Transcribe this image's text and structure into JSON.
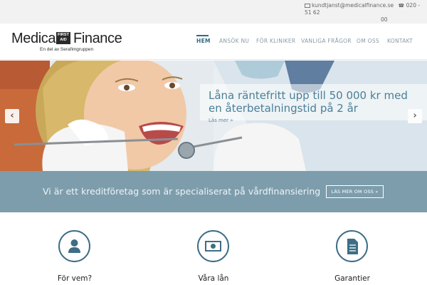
{
  "topbar": {
    "email": "kundtjanst@medicalfinance.se",
    "phone_part1": "020 - 51 62",
    "phone_part2": "00"
  },
  "logo": {
    "word1": "Medical",
    "badge_line1": "FIRST",
    "badge_line2": "AID",
    "word2": "Finance",
    "tagline": "En del av Serafimgruppen"
  },
  "nav": {
    "items": [
      "HEM",
      "ANSÖK NU",
      "FÖR KLINIKER",
      "VANLIGA FRÅGOR",
      "OM OSS",
      "KONTAKT"
    ],
    "active": "HEM"
  },
  "hero": {
    "title": "Låna räntefritt upp till 50 000 kr med en återbetalningstid på 2 år",
    "link": "Läs mer »",
    "prev_symbol": "‹",
    "next_symbol": "›"
  },
  "banner": {
    "text": "Vi är ett kreditföretag som är specialiserat på vårdfinansiering",
    "button": "LÄS MER OM OSS »"
  },
  "features": [
    {
      "label": "För vem?",
      "icon": "user-icon"
    },
    {
      "label": "Våra lån",
      "icon": "money-icon"
    },
    {
      "label": "Garantier",
      "icon": "document-icon"
    }
  ],
  "colors": {
    "accent": "#2f6a87",
    "banner": "#7d9dac",
    "caption_text": "#4a7f97"
  }
}
